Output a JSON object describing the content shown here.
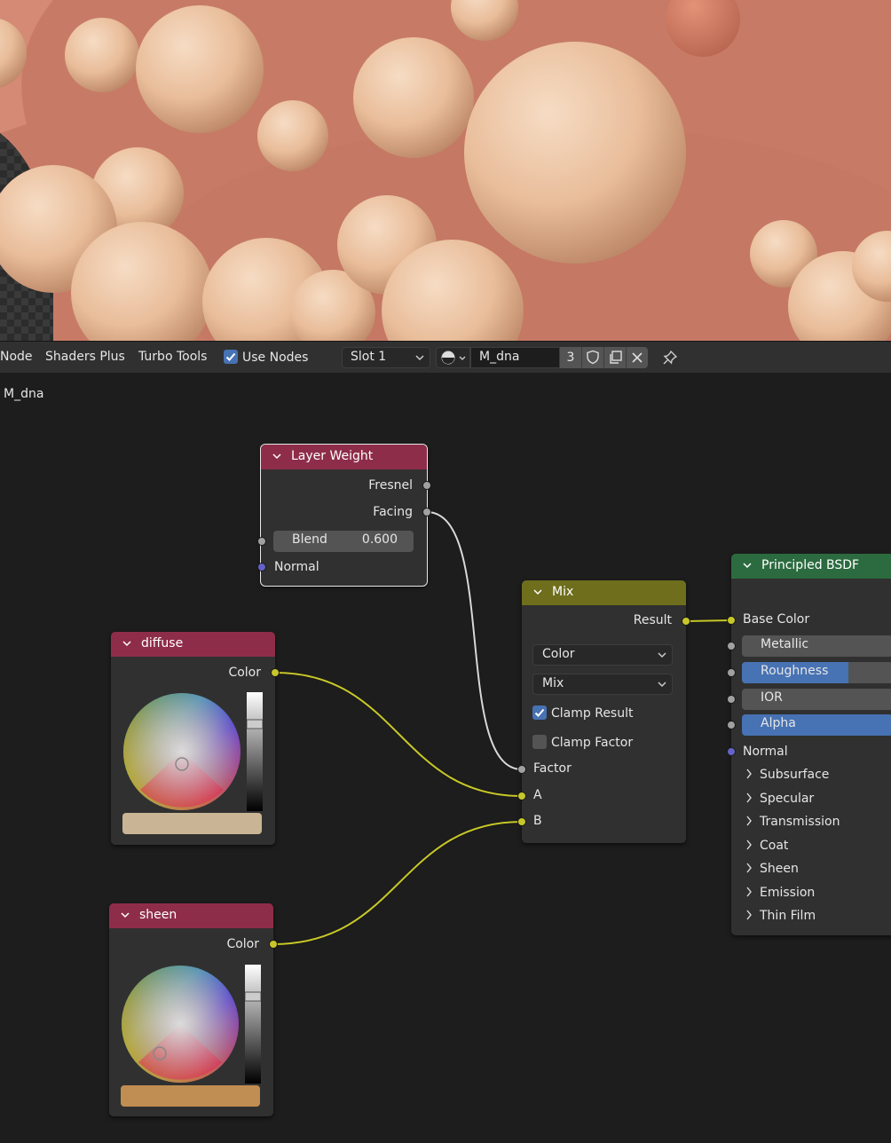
{
  "header": {
    "menu_node": "Node",
    "menu_shaders_plus": "Shaders Plus",
    "menu_turbo_tools": "Turbo Tools",
    "use_nodes_label": "Use Nodes",
    "use_nodes_checked": true,
    "slot": "Slot 1",
    "material_name": "M_dna",
    "user_count": "3"
  },
  "breadcrumb": "M_dna",
  "nodes": {
    "layer_weight": {
      "title": "Layer Weight",
      "out_fresnel": "Fresnel",
      "out_facing": "Facing",
      "blend_label": "Blend",
      "blend_value": "0.600",
      "in_normal": "Normal"
    },
    "diffuse": {
      "title": "diffuse",
      "out_color": "Color",
      "swatch_color": "#c9b595"
    },
    "sheen": {
      "title": "sheen",
      "out_color": "Color",
      "swatch_color": "#c08d52"
    },
    "mix": {
      "title": "Mix",
      "out_result": "Result",
      "data_type": "Color",
      "blend_type": "Mix",
      "clamp_result_label": "Clamp Result",
      "clamp_result_checked": true,
      "clamp_factor_label": "Clamp Factor",
      "clamp_factor_checked": false,
      "in_factor": "Factor",
      "in_a": "A",
      "in_b": "B"
    },
    "principled": {
      "title": "Principled BSDF",
      "in_base_color": "Base Color",
      "metallic": "Metallic",
      "roughness": "Roughness",
      "ior": "IOR",
      "alpha": "Alpha",
      "in_normal": "Normal",
      "panels": [
        "Subsurface",
        "Specular",
        "Transmission",
        "Coat",
        "Sheen",
        "Emission",
        "Thin Film"
      ]
    }
  },
  "colors": {
    "header_input": "#8e2d49",
    "header_converter": "#6e6e1d",
    "header_shader": "#2b6b3f",
    "socket_color": "#c7c729",
    "socket_float": "#a1a1a1",
    "socket_vector": "#6363c7",
    "accent": "#4772b3",
    "viewport_bg": "#c77b66"
  }
}
